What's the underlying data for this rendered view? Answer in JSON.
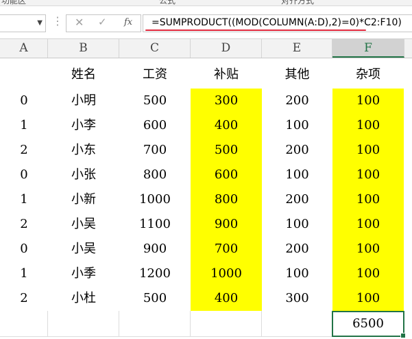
{
  "ribbon": {
    "fragment_left": "功能区",
    "fragment_mid": "公式",
    "fragment_right": "对齐方式"
  },
  "formula_bar": {
    "name_box": "",
    "cancel_icon": "✕",
    "enter_icon": "✓",
    "fx_label": "fx",
    "formula": "=SUMPRODUCT((MOD(COLUMN(A:D),2)=0)*C2:F10)"
  },
  "columns": [
    "A",
    "B",
    "C",
    "D",
    "E",
    "F"
  ],
  "selected_column": "F",
  "header_row": [
    "",
    "姓名",
    "工资",
    "补贴",
    "其他",
    "杂项"
  ],
  "rows": [
    [
      "0",
      "小明",
      "500",
      "300",
      "200",
      "100"
    ],
    [
      "1",
      "小李",
      "600",
      "400",
      "100",
      "100"
    ],
    [
      "2",
      "小东",
      "700",
      "500",
      "200",
      "100"
    ],
    [
      "0",
      "小张",
      "800",
      "600",
      "100",
      "100"
    ],
    [
      "1",
      "小新",
      "1000",
      "800",
      "200",
      "100"
    ],
    [
      "2",
      "小吴",
      "1100",
      "900",
      "100",
      "100"
    ],
    [
      "0",
      "小吴",
      "900",
      "700",
      "200",
      "100"
    ],
    [
      "1",
      "小季",
      "1200",
      "1000",
      "100",
      "100"
    ],
    [
      "2",
      "小杜",
      "500",
      "400",
      "300",
      "100"
    ]
  ],
  "result": "6500",
  "highlight_color": "#ffff00",
  "accent_color": "#217346",
  "underline_color": "#e0283c"
}
